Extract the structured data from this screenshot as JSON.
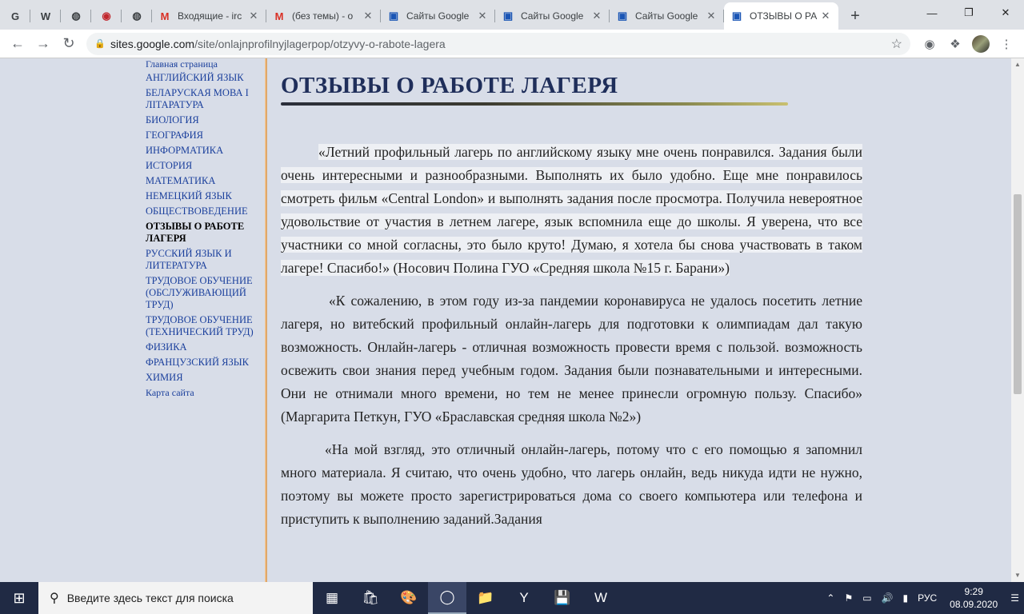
{
  "browser": {
    "tabs": [
      {
        "favicon": "google-icon",
        "glyph": "G",
        "label": "",
        "pinned": true
      },
      {
        "favicon": "wikipedia-icon",
        "glyph": "W",
        "label": "",
        "pinned": true
      },
      {
        "favicon": "globe-icon",
        "glyph": "◍",
        "label": "",
        "pinned": true
      },
      {
        "favicon": "opera-icon",
        "glyph": "◉",
        "label": "",
        "pinned": true
      },
      {
        "favicon": "globe-icon",
        "glyph": "◍",
        "label": "",
        "pinned": true
      },
      {
        "favicon": "gmail-icon",
        "glyph": "M",
        "label": "Входящие - irc"
      },
      {
        "favicon": "gmail-icon",
        "glyph": "M",
        "label": "(без темы) - о"
      },
      {
        "favicon": "google-sites-icon",
        "glyph": "▣",
        "label": "Сайты Google"
      },
      {
        "favicon": "google-sites-icon",
        "glyph": "▣",
        "label": "Сайты Google"
      },
      {
        "favicon": "google-sites-icon",
        "glyph": "▣",
        "label": "Сайты Google"
      },
      {
        "favicon": "google-sites-icon",
        "glyph": "▣",
        "label": "ОТЗЫВЫ О РА",
        "active": true
      }
    ],
    "url_host": "sites.google.com",
    "url_path": "/site/onlajnprofilnyjlagerpop/otzyvy-o-rabote-lagera"
  },
  "sidebar": {
    "items": [
      {
        "label": "Главная страница"
      },
      {
        "label": "АНГЛИЙСКИЙ ЯЗЫК"
      },
      {
        "label": "БЕЛАРУСКАЯ МОВА І ЛІТАРАТУРА"
      },
      {
        "label": "БИОЛОГИЯ"
      },
      {
        "label": "ГЕОГРАФИЯ"
      },
      {
        "label": "ИНФОРМАТИКА"
      },
      {
        "label": "ИСТОРИЯ"
      },
      {
        "label": "МАТЕМАТИКА"
      },
      {
        "label": "НЕМЕЦКИЙ ЯЗЫК"
      },
      {
        "label": "ОБЩЕСТВОВЕДЕНИЕ"
      },
      {
        "label": "ОТЗЫВЫ О РАБОТЕ ЛАГЕРЯ",
        "current": true
      },
      {
        "label": "РУССКИЙ ЯЗЫК И ЛИТЕРАТУРА"
      },
      {
        "label": "ТРУДОВОЕ ОБУЧЕНИЕ (ОБСЛУЖИВАЮЩИЙ ТРУД)"
      },
      {
        "label": "ТРУДОВОЕ ОБУЧЕНИЕ (ТЕХНИЧЕСКИЙ ТРУД)"
      },
      {
        "label": "ФИЗИКА"
      },
      {
        "label": "ФРАНЦУЗСКИЙ ЯЗЫК"
      },
      {
        "label": "ХИМИЯ"
      },
      {
        "label": "Карта сайта"
      }
    ]
  },
  "page": {
    "title": "ОТЗЫВЫ О РАБОТЕ ЛАГЕРЯ",
    "reviews": [
      "«Летний профильный лагерь по английскому языку мне очень понравился. Задания были очень интересными и разнообразными. Выполнять их было удобно. Еще мне понравилось смотреть фильм «Central London» и выполнять задания после просмотра. Получила невероятное удовольствие от участия в летнем лагере, язык вспомнила еще до школы. Я уверена, что все участники со мной согласны, это было круто! Думаю, я хотела бы снова участвовать в таком лагере! Спасибо!» (Носович Полина ГУО «Средняя школа №15 г. Барани»)",
      "«К сожалению, в этом году из-за пандемии коронавируса не удалось посетить летние лагеря, но витебский профильный онлайн-лагерь для подготовки к олимпиадам дал такую возможность. Онлайн-лагерь - отличная возможность провести время с пользой. возможность освежить свои знания перед учебным годом. Задания были познавательными и интересными. Они не отнимали много времени, но тем не менее принесли огромную пользу. Спасибо» (Маргарита Петкун, ГУО «Браславская средняя школа №2»)",
      "«На мой взгляд, это отличный онлайн-лагерь, потому что с его помощью я запомнил много материала. Я считаю, что очень удобно, что лагерь онлайн, ведь никуда идти не нужно, поэтому вы можете просто зарегистрироваться дома со своего компьютера или телефона и приступить к выполнению заданий.Задания"
    ]
  },
  "taskbar": {
    "search_placeholder": "Введите здесь текст для поиска",
    "language": "РУС",
    "time": "9:29",
    "date": "08.09.2020"
  }
}
